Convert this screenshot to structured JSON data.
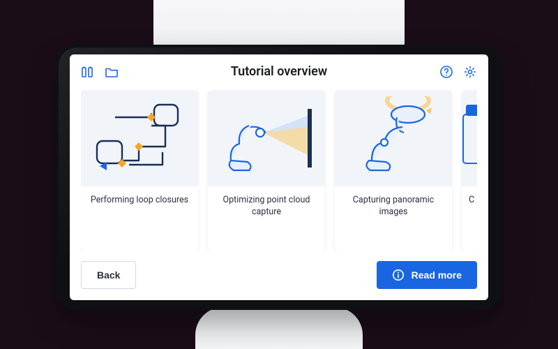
{
  "header": {
    "title": "Tutorial overview",
    "icons": {
      "battery": "battery-icon",
      "folder": "folder-icon",
      "help": "help-icon",
      "settings": "gear-icon"
    }
  },
  "tutorials": [
    {
      "label": "Performing loop closures",
      "thumb_kind": "loop"
    },
    {
      "label": "Optimizing point cloud capture",
      "thumb_kind": "scan"
    },
    {
      "label": "Capturing panoramic images",
      "thumb_kind": "pano"
    }
  ],
  "tutorial_peek": {
    "label_first_char": "C"
  },
  "footer": {
    "back_label": "Back",
    "readmore_label": "Read more"
  },
  "colors": {
    "accent": "#1a66e2",
    "thumb_bg": "#f1f4f9",
    "amber": "#f5c76a"
  }
}
